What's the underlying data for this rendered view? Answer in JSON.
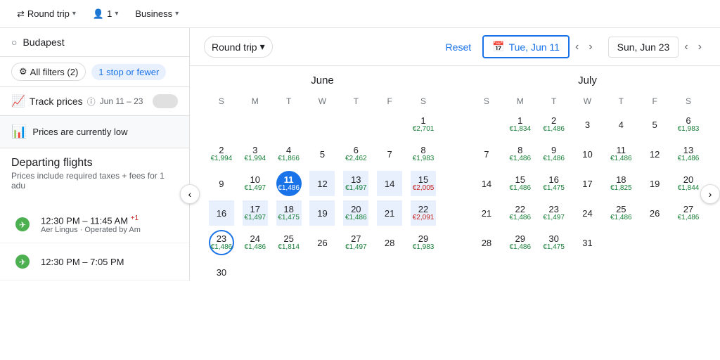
{
  "topbar": {
    "roundtrip_label": "Round trip",
    "passengers_label": "1",
    "class_label": "Business"
  },
  "sidebar": {
    "search_placeholder": "Budapest",
    "filters_label": "All filters (2)",
    "chip_label": "1 stop or fewer",
    "track_label": "Track prices",
    "track_range": "Jun 11 – 23",
    "prices_text": "Prices are currently low",
    "departing_title": "Departing flights",
    "departing_sub": "Prices include required taxes + fees for 1 adu",
    "flights": [
      {
        "time": "12:30 PM – 11:45 AM",
        "suffix": "+1",
        "airline": "Aer Lingus · Operated by Am"
      },
      {
        "time": "12:30 PM – 7:05 PM",
        "suffix": "",
        "airline": ""
      }
    ]
  },
  "calendar": {
    "roundtrip_label": "Round trip",
    "reset_label": "Reset",
    "date_start": "Tue, Jun 11",
    "date_end": "Sun, Jun 23",
    "june": {
      "month": "June",
      "days_of_week": [
        "S",
        "M",
        "T",
        "W",
        "T",
        "F",
        "S"
      ],
      "weeks": [
        [
          null,
          null,
          null,
          null,
          null,
          null,
          {
            "n": 1,
            "p": "€2,701",
            "hi": false
          }
        ],
        [
          {
            "n": 2,
            "p": "€1,994",
            "hi": false
          },
          {
            "n": 3,
            "p": "€1,994",
            "hi": false
          },
          {
            "n": 4,
            "p": "€1,866",
            "hi": false
          },
          {
            "n": 5,
            "p": null
          },
          {
            "n": 6,
            "p": "€2,462",
            "hi": false
          },
          {
            "n": 7,
            "p": null
          },
          {
            "n": 8,
            "p": "€1,983",
            "hi": false
          }
        ],
        [
          {
            "n": 9,
            "p": null
          },
          {
            "n": 10,
            "p": "€1,497",
            "hi": false
          },
          {
            "n": 11,
            "p": "€1,486",
            "sel": "start"
          },
          {
            "n": 12,
            "p": null,
            "range": true
          },
          {
            "n": 13,
            "p": "€1,497",
            "range": true
          },
          {
            "n": 14,
            "p": null,
            "range": true
          },
          {
            "n": 15,
            "p": "€2,005",
            "range": true,
            "hi": true
          }
        ],
        [
          {
            "n": 16,
            "p": null,
            "range": true
          },
          {
            "n": 17,
            "p": "€1,497",
            "range": true
          },
          {
            "n": 18,
            "p": "€1,475",
            "range": true
          },
          {
            "n": 19,
            "p": null,
            "range": true
          },
          {
            "n": 20,
            "p": "€1,486",
            "range": true
          },
          {
            "n": 21,
            "p": null,
            "range": true
          },
          {
            "n": 22,
            "p": "€2,091",
            "range": true,
            "hi": true
          }
        ],
        [
          {
            "n": 23,
            "p": "€1,486",
            "sel": "end"
          },
          {
            "n": 24,
            "p": "€1,486",
            "hi": false
          },
          {
            "n": 25,
            "p": "€1,814",
            "hi": false
          },
          {
            "n": 26,
            "p": null
          },
          {
            "n": 27,
            "p": "€1,497",
            "hi": false
          },
          {
            "n": 28,
            "p": null
          },
          {
            "n": 29,
            "p": "€1,983",
            "hi": false
          }
        ],
        [
          {
            "n": 30,
            "p": null
          },
          null,
          null,
          null,
          null,
          null,
          null
        ]
      ]
    },
    "july": {
      "month": "July",
      "days_of_week": [
        "S",
        "M",
        "T",
        "W",
        "T",
        "F",
        "S"
      ],
      "weeks": [
        [
          null,
          {
            "n": 1,
            "p": "€1,834",
            "hi": false
          },
          {
            "n": 2,
            "p": "€1,486",
            "hi": false
          },
          {
            "n": 3,
            "p": null
          },
          {
            "n": 4,
            "p": null
          },
          {
            "n": 5,
            "p": null
          },
          {
            "n": 6,
            "p": "€1,983",
            "hi": false
          }
        ],
        [
          {
            "n": 7,
            "p": null
          },
          {
            "n": 8,
            "p": "€1,486",
            "hi": false
          },
          {
            "n": 9,
            "p": "€1,486",
            "hi": false
          },
          {
            "n": 10,
            "p": null
          },
          {
            "n": 11,
            "p": "€1,486",
            "hi": false
          },
          {
            "n": 12,
            "p": null
          },
          {
            "n": 13,
            "p": "€1,486",
            "hi": false
          }
        ],
        [
          {
            "n": 14,
            "p": null
          },
          {
            "n": 15,
            "p": "€1,486",
            "hi": false
          },
          {
            "n": 16,
            "p": "€1,475",
            "hi": false
          },
          {
            "n": 17,
            "p": null
          },
          {
            "n": 18,
            "p": "€1,825",
            "hi": false
          },
          {
            "n": 19,
            "p": null
          },
          {
            "n": 20,
            "p": "€1,844",
            "hi": false
          }
        ],
        [
          {
            "n": 21,
            "p": null
          },
          {
            "n": 22,
            "p": "€1,486",
            "hi": false
          },
          {
            "n": 23,
            "p": "€1,497",
            "hi": false
          },
          {
            "n": 24,
            "p": null
          },
          {
            "n": 25,
            "p": "€1,486",
            "hi": false
          },
          {
            "n": 26,
            "p": null
          },
          {
            "n": 27,
            "p": "€1,486",
            "hi": false
          }
        ],
        [
          {
            "n": 28,
            "p": null
          },
          {
            "n": 29,
            "p": "€1,486",
            "hi": false
          },
          {
            "n": 30,
            "p": "€1,475",
            "hi": false
          },
          {
            "n": 31,
            "p": null
          },
          null,
          null,
          null
        ]
      ]
    }
  }
}
